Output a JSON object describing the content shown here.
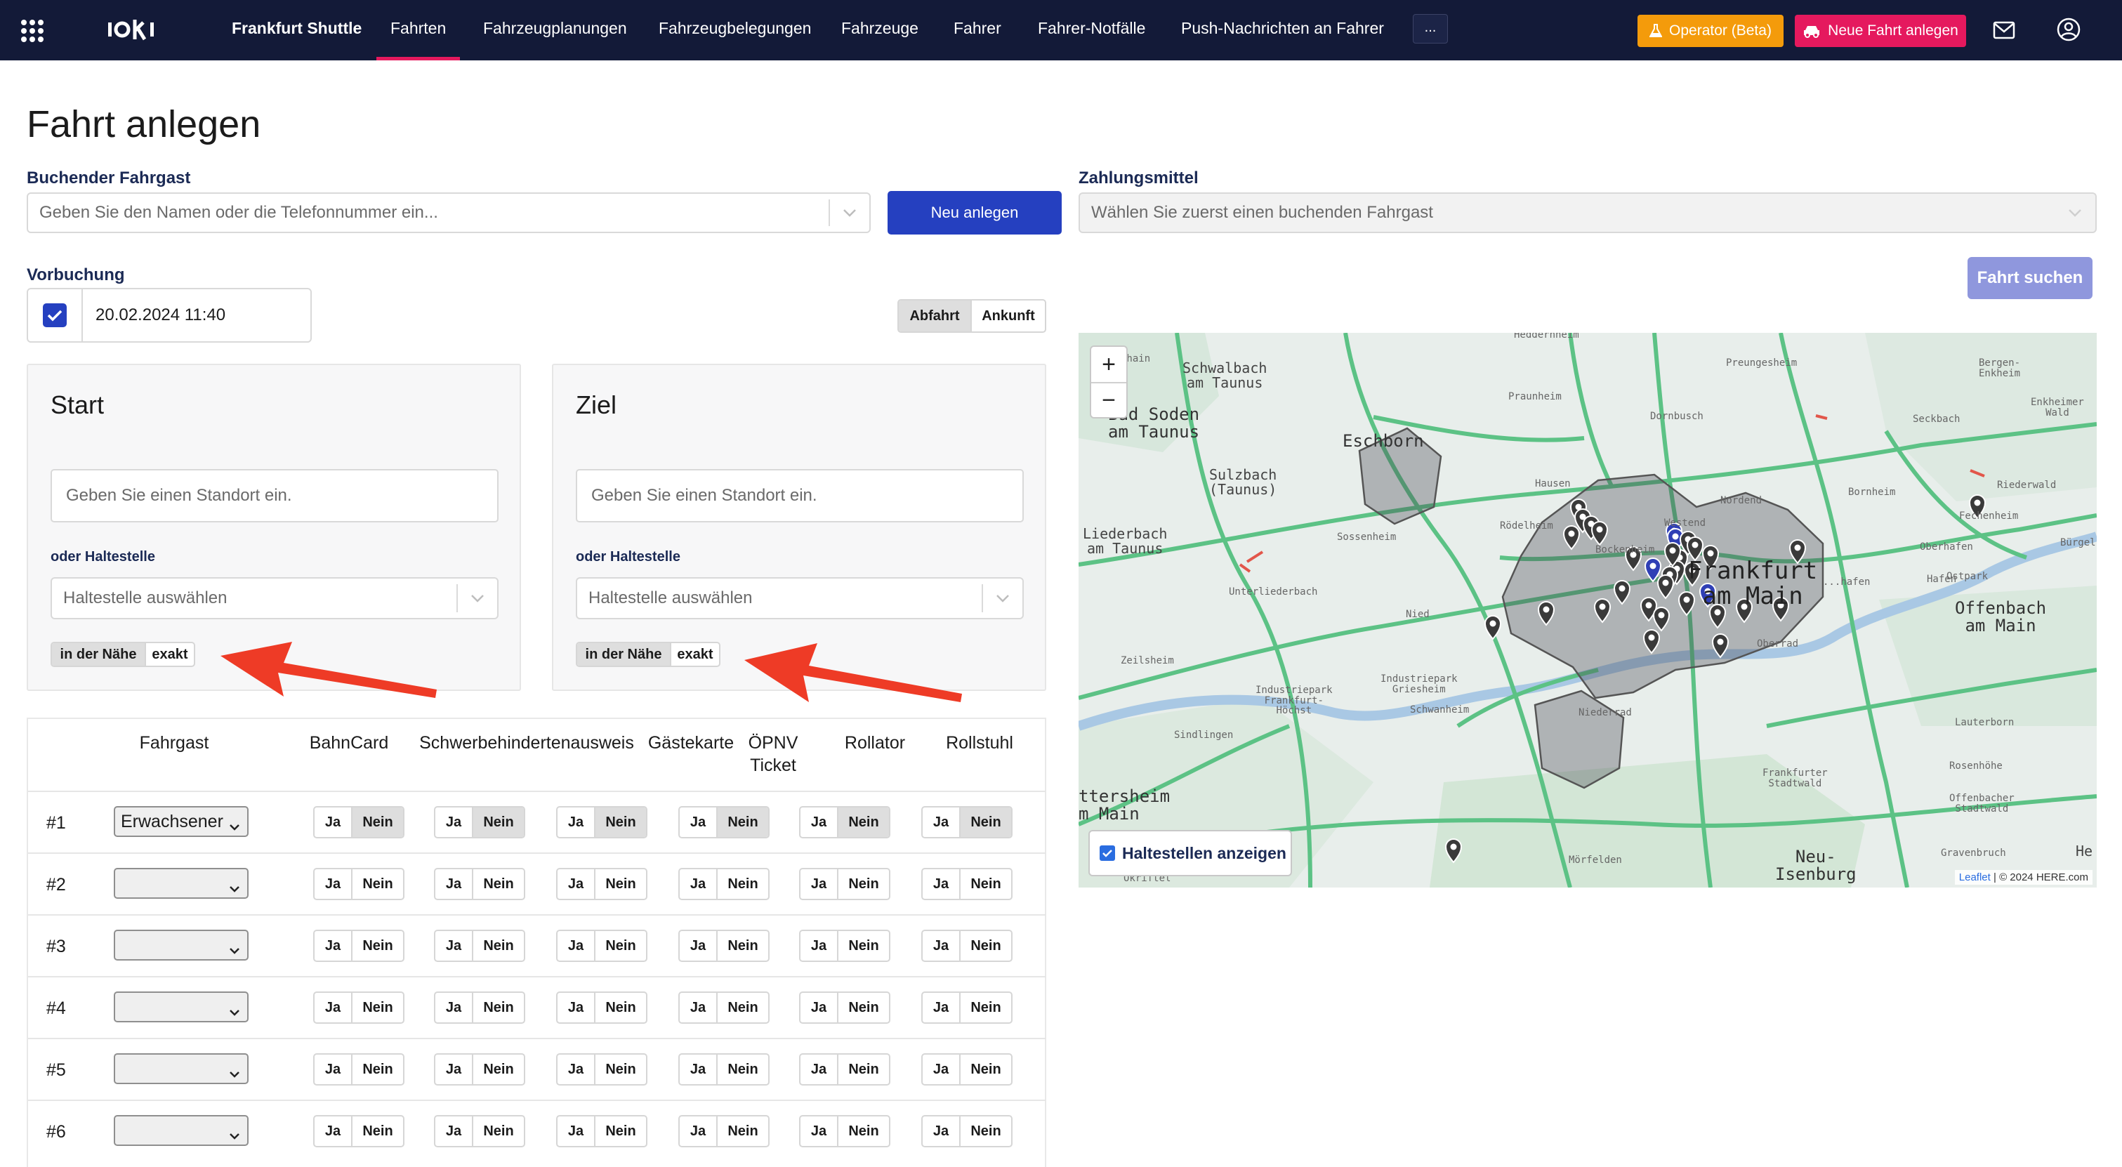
{
  "nav": {
    "items": [
      {
        "label": "Frankfurt Shuttle"
      },
      {
        "label": "Fahrten"
      },
      {
        "label": "Fahrzeugplanungen"
      },
      {
        "label": "Fahrzeugbelegungen"
      },
      {
        "label": "Fahrzeuge"
      },
      {
        "label": "Fahrer"
      },
      {
        "label": "Fahrer-Notfälle"
      },
      {
        "label": "Push-Nachrichten an Fahrer"
      }
    ],
    "more_label": "...",
    "operator_label": "Operator (Beta)",
    "new_ride_label": "Neue Fahrt anlegen",
    "colors": {
      "bar": "#131a38",
      "accent": "#e5195e",
      "operator": "#f49b0b"
    }
  },
  "page": {
    "title": "Fahrt anlegen"
  },
  "booking": {
    "passenger_label": "Buchender Fahrgast",
    "passenger_placeholder": "Geben Sie den Namen oder die Telefonnummer ein...",
    "new_button": "Neu anlegen",
    "payment_label": "Zahlungsmittel",
    "payment_placeholder": "Wählen Sie zuerst einen buchenden Fahrgast",
    "search_button": "Fahrt suchen",
    "prebooking_label": "Vorbuchung",
    "prebooking_checked": true,
    "datetime": "20.02.2024 11:40",
    "time_mode": {
      "departure": "Abfahrt",
      "arrival": "Ankunft",
      "selected": "Abfahrt"
    }
  },
  "start": {
    "title": "Start",
    "location_placeholder": "Geben Sie einen Standort ein.",
    "stop_label": "oder Haltestelle",
    "stop_placeholder": "Haltestelle auswählen",
    "mode_near": "in der Nähe",
    "mode_exact": "exakt",
    "mode_selected": "in der Nähe"
  },
  "destination": {
    "title": "Ziel",
    "location_placeholder": "Geben Sie einen Standort ein.",
    "stop_label": "oder Haltestelle",
    "stop_placeholder": "Haltestelle auswählen",
    "mode_near": "in der Nähe",
    "mode_exact": "exakt",
    "mode_selected": "in der Nähe"
  },
  "passengers": {
    "columns": [
      "Fahrgast",
      "BahnCard",
      "Schwerbehindertenausweis",
      "Gästekarte",
      "ÖPNV Ticket",
      "Rollator",
      "Rollstuhl"
    ],
    "yes": "Ja",
    "no": "Nein",
    "rows": [
      {
        "num": "#1",
        "type": "Erwachsener",
        "selected_no": true
      },
      {
        "num": "#2",
        "type": "",
        "selected_no": false
      },
      {
        "num": "#3",
        "type": "",
        "selected_no": false
      },
      {
        "num": "#4",
        "type": "",
        "selected_no": false
      },
      {
        "num": "#5",
        "type": "",
        "selected_no": false
      },
      {
        "num": "#6",
        "type": "",
        "selected_no": false
      }
    ]
  },
  "map": {
    "zoom_in": "+",
    "zoom_out": "−",
    "show_stops_label": "Haltestellen anzeigen",
    "show_stops_checked": true,
    "attribution_leaflet": "Leaflet",
    "attribution_rest": "| © 2024 HERE.com",
    "labels": {
      "schwalbach": "Schwalbach\nam Taunus",
      "badsoden": "Bad Soden\nam Taunus",
      "eschborn": "Eschborn",
      "sulzbach": "Sulzbach\n(Taunus)",
      "liederbach": "Liederbach\nam Taunus",
      "frankfurt": "Frankfurt\nam Main",
      "offenbach": "Offenbach\nam Main",
      "hattersheim": "ttersheim\nm Main",
      "neuisenburg": "Neu-\nIsenburg",
      "heddernheim": "Heddernheim",
      "praunheim": "Praunheim",
      "preungesheim": "Preungesheim",
      "bergen": "Bergen-\nEnkheim",
      "enkheimerwald": "Enkheimer\nWald",
      "seckbach": "Seckbach",
      "dornbusch": "Dornbusch",
      "bornheim": "Bornheim",
      "nordend": "Nordend",
      "fechenheim": "Fechenheim",
      "roedelheim": "Rödelheim",
      "sossenheim": "Sossenheim",
      "hausen": "Hausen",
      "bockenheim": "Bockenheim",
      "westend": "Westend",
      "unterliederbach": "Unterliederbach",
      "nied": "Nied",
      "zeilsheim": "Zeilsheim",
      "industriepark": "Industriepark\nFrankfurt-\nHöchst",
      "griesheim": "Industriepark\nGriesheim",
      "schwanheim": "Schwanheim",
      "sindlingen": "Sindlingen",
      "niederrad": "Niederrad",
      "oberrad": "Oberrad",
      "frankfurterstadtwald": "Frankfurter\nStadtwald",
      "lauterborn": "Lauterborn",
      "rosenhoehe": "Rosenhöhe",
      "offenbacherstadtwald": "Offenbacher\nStadtwald",
      "gravenbruch": "Gravenbruch",
      "oberhafen": "Oberhafen",
      "buergel": "Bürgel",
      "hafen": "Hafen",
      "ostpark": "Ostpark",
      "riederwald": "Riederwald",
      "mvald": "Mörfelden",
      "okriftel": "Okriftel",
      "he": "He",
      "sachsenhausen": "...hafen",
      "hainer": "nhain"
    }
  }
}
